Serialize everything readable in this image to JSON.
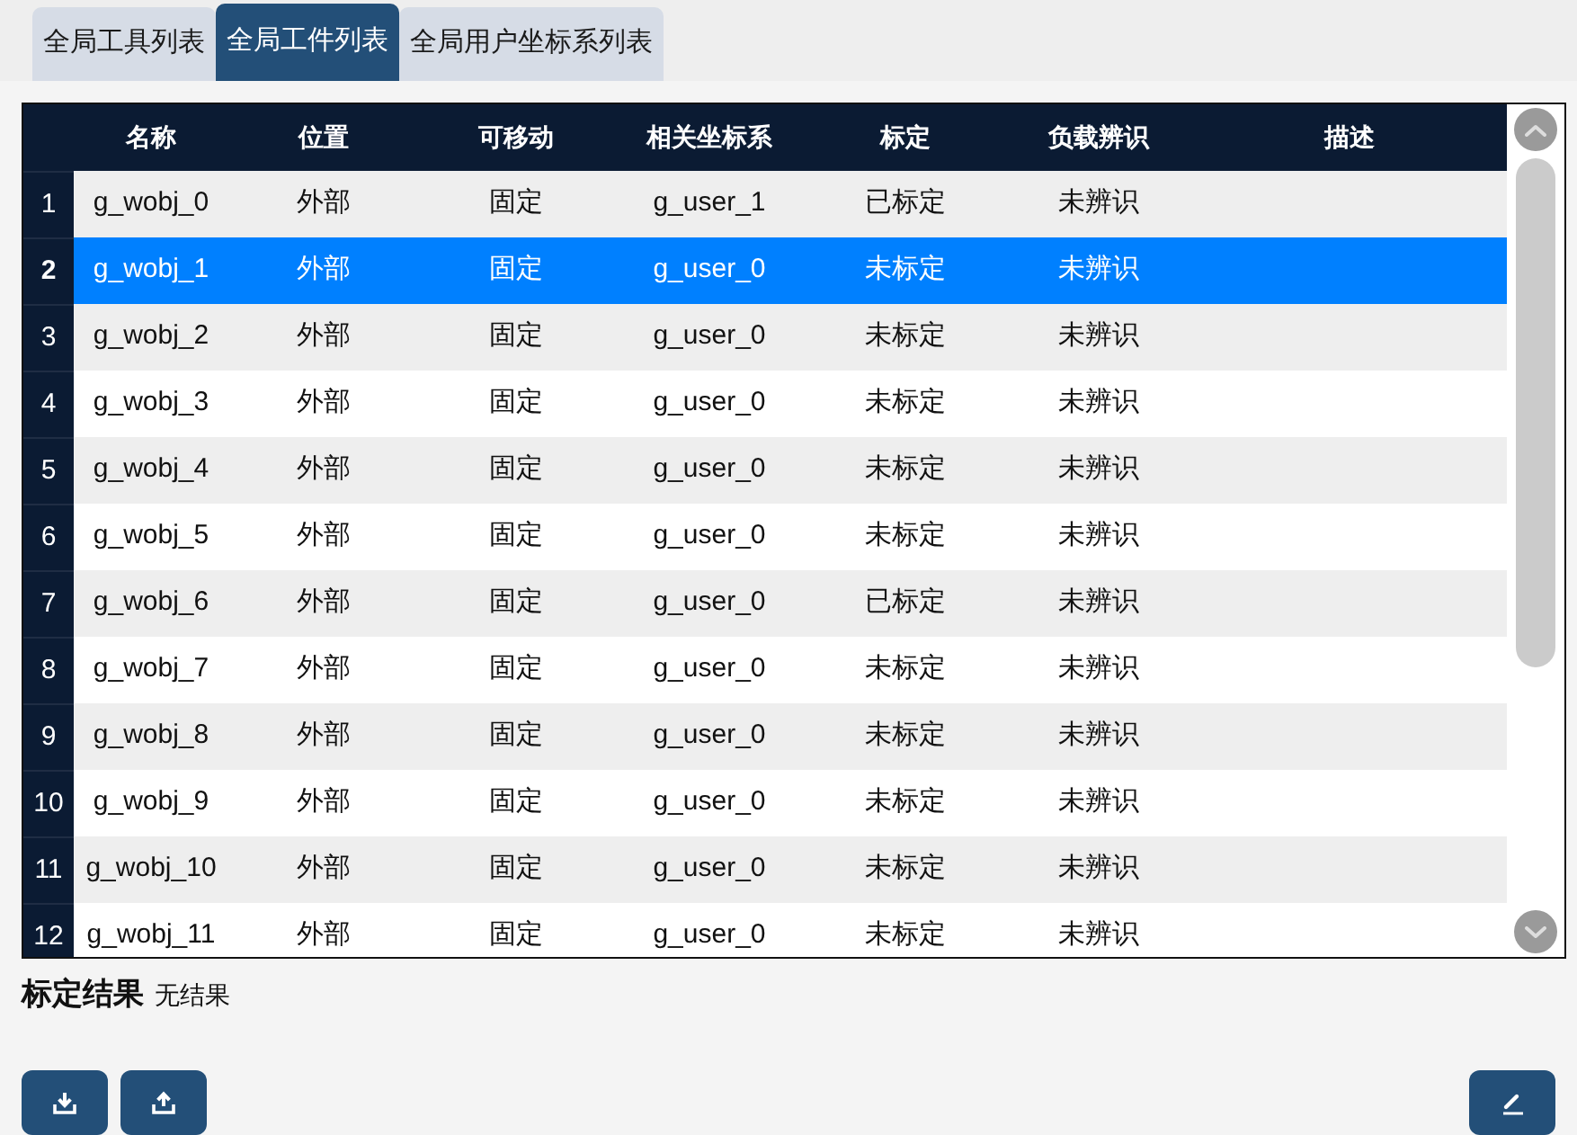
{
  "tabs": [
    {
      "label": "全局工具列表",
      "selected": false
    },
    {
      "label": "全局工件列表",
      "selected": true
    },
    {
      "label": "全局用户坐标系列表",
      "selected": false
    }
  ],
  "table": {
    "columns": [
      "名称",
      "位置",
      "可移动",
      "相关坐标系",
      "标定",
      "负载辨识",
      "描述"
    ],
    "rows": [
      {
        "number": "1",
        "selected": false,
        "cells": [
          "g_wobj_0",
          "外部",
          "固定",
          "g_user_1",
          "已标定",
          "未辨识"
        ]
      },
      {
        "number": "2",
        "selected": true,
        "cells": [
          "g_wobj_1",
          "外部",
          "固定",
          "g_user_0",
          "未标定",
          "未辨识"
        ]
      },
      {
        "number": "3",
        "selected": false,
        "cells": [
          "g_wobj_2",
          "外部",
          "固定",
          "g_user_0",
          "未标定",
          "未辨识"
        ]
      },
      {
        "number": "4",
        "selected": false,
        "cells": [
          "g_wobj_3",
          "外部",
          "固定",
          "g_user_0",
          "未标定",
          "未辨识"
        ]
      },
      {
        "number": "5",
        "selected": false,
        "cells": [
          "g_wobj_4",
          "外部",
          "固定",
          "g_user_0",
          "未标定",
          "未辨识"
        ]
      },
      {
        "number": "6",
        "selected": false,
        "cells": [
          "g_wobj_5",
          "外部",
          "固定",
          "g_user_0",
          "未标定",
          "未辨识"
        ]
      },
      {
        "number": "7",
        "selected": false,
        "cells": [
          "g_wobj_6",
          "外部",
          "固定",
          "g_user_0",
          "已标定",
          "未辨识"
        ]
      },
      {
        "number": "8",
        "selected": false,
        "cells": [
          "g_wobj_7",
          "外部",
          "固定",
          "g_user_0",
          "未标定",
          "未辨识"
        ]
      },
      {
        "number": "9",
        "selected": false,
        "cells": [
          "g_wobj_8",
          "外部",
          "固定",
          "g_user_0",
          "未标定",
          "未辨识"
        ]
      },
      {
        "number": "10",
        "selected": false,
        "cells": [
          "g_wobj_9",
          "外部",
          "固定",
          "g_user_0",
          "未标定",
          "未辨识"
        ]
      },
      {
        "number": "11",
        "selected": false,
        "cells": [
          "g_wobj_10",
          "外部",
          "固定",
          "g_user_0",
          "未标定",
          "未辨识"
        ]
      },
      {
        "number": "12",
        "selected": false,
        "cells": [
          "g_wobj_11",
          "外部",
          "固定",
          "g_user_0",
          "未标定",
          "未辨识"
        ]
      }
    ]
  },
  "calibration_result": {
    "label": "标定结果",
    "value": "无结果"
  },
  "left_buttons": [
    {
      "kind": "download"
    },
    {
      "kind": "upload"
    }
  ],
  "right_buttons": [
    {
      "kind": "edit"
    }
  ]
}
